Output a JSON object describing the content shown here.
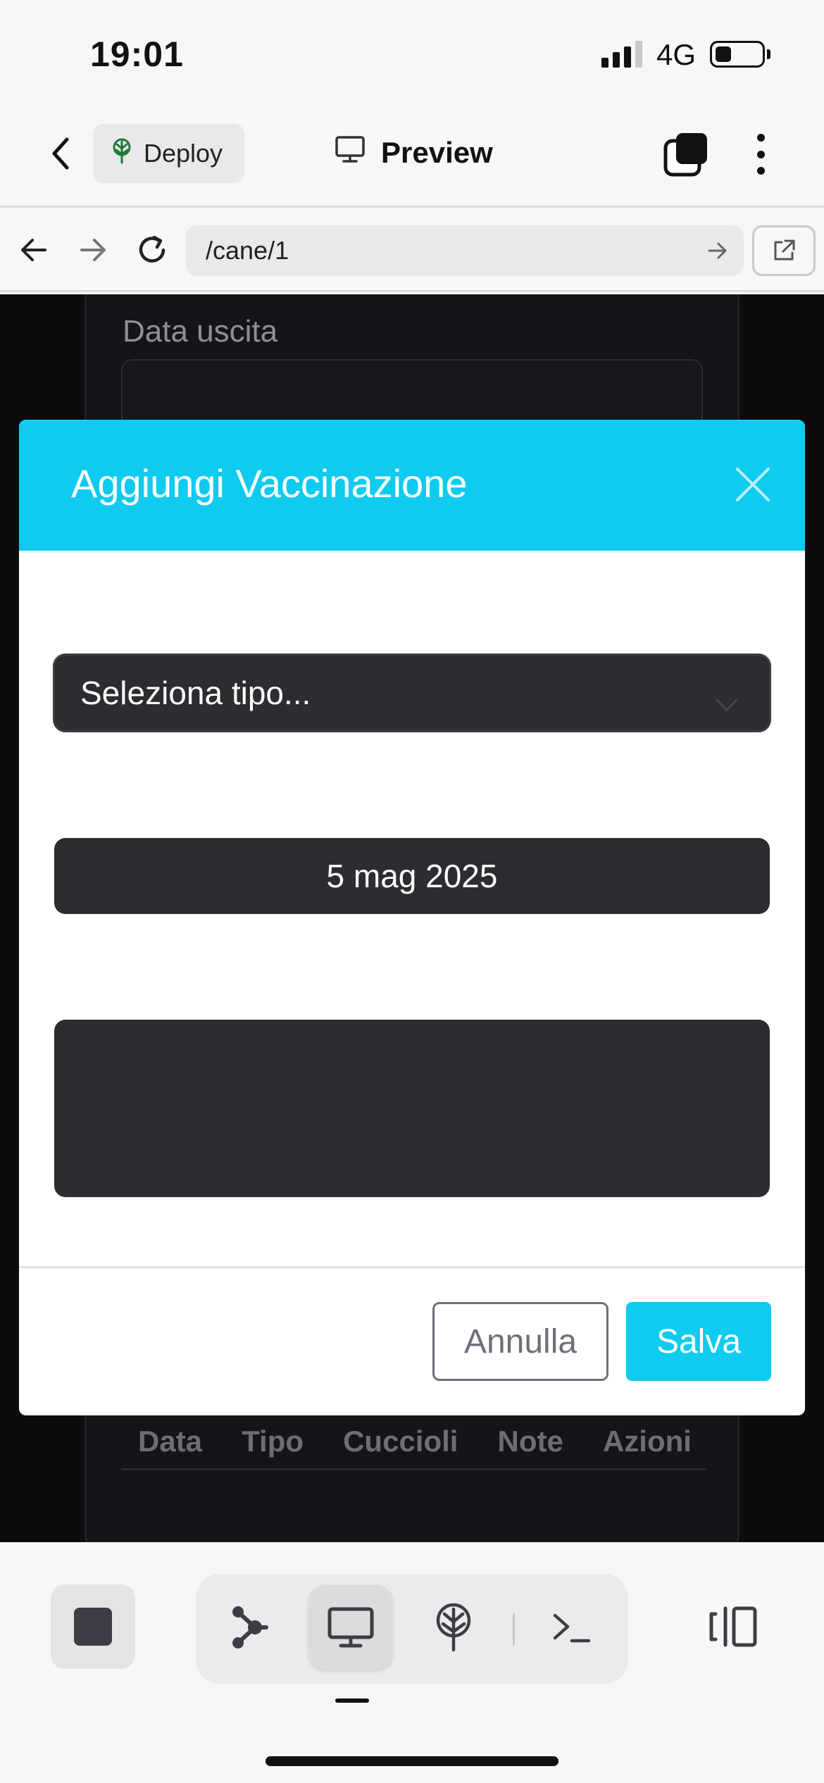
{
  "status_bar": {
    "time": "19:01",
    "network": "4G"
  },
  "header": {
    "deploy_label": "Deploy",
    "preview_label": "Preview"
  },
  "browser": {
    "url": "/cane/1"
  },
  "background_page": {
    "field_label": "Data uscita",
    "table_headers": [
      "Data",
      "Tipo",
      "Cuccioli",
      "Note",
      "Azioni"
    ]
  },
  "modal": {
    "title": "Aggiungi Vaccinazione",
    "type_select_placeholder": "Seleziona tipo...",
    "date_value": "5 mag 2025",
    "notes_value": "",
    "cancel_label": "Annulla",
    "save_label": "Salva"
  },
  "colors": {
    "accent": "#0ecbef",
    "field_bg": "#2c2c31",
    "page_bg": "#0c0c0e"
  },
  "icons": [
    "back-chevron-icon",
    "deploy-tree-icon",
    "monitor-icon",
    "tabs-icon",
    "more-vertical-icon",
    "arrow-left-icon",
    "arrow-right-icon",
    "reload-icon",
    "external-link-icon",
    "close-icon",
    "chevron-down-icon",
    "stop-icon",
    "branch-icon",
    "deploy-icon",
    "terminal-icon",
    "panel-icon"
  ]
}
